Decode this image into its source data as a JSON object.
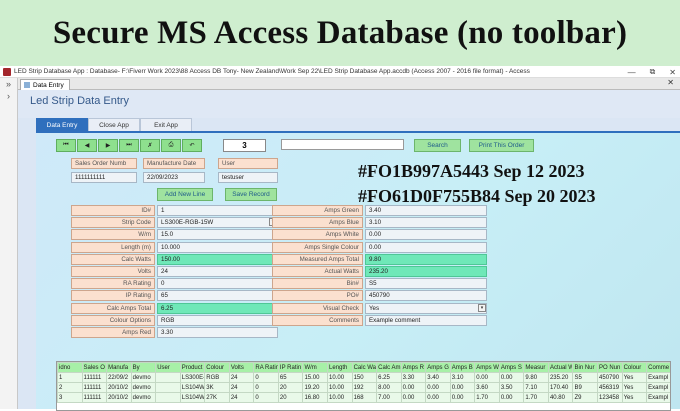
{
  "banner": {
    "title": "Secure MS Access Database (no toolbar)"
  },
  "window": {
    "title": "LED Strip Database App : Database- F:\\Fiverr Work 2023\\88 Access DB Tony- New Zealand\\Work Sep 22\\LED Strip Database App.accdb (Access 2007 - 2016 file format) - Access",
    "minimize": "—",
    "restore": "⧉",
    "close": "✕"
  },
  "nav": {
    "expand": "»",
    "collapse": "›"
  },
  "doc_tab": {
    "label": "Data Entry",
    "close": "✕"
  },
  "form": {
    "title": "Led Strip Data Entry",
    "tabs": [
      {
        "label": "Data Entry"
      },
      {
        "label": "Close App"
      },
      {
        "label": "Exit App"
      }
    ],
    "nav_buttons": {
      "first": "⏮",
      "prev": "◀",
      "next": "▶",
      "last": "⏭",
      "delete": "✗",
      "print": "⎙",
      "undo": "↶"
    },
    "record_number": "3",
    "search_value": "",
    "search_label": "Search",
    "print_order_label": "Print This Order",
    "add_new_line_label": "Add New Line",
    "save_record_label": "Save Record",
    "dropdown_glyph": "▾",
    "header_fields": {
      "sales_order_label": "Sales Order Numb",
      "sales_order_value": "1111111111",
      "manufacture_date_label": "Manufacture Date",
      "manufacture_date_value": "22/09/2023",
      "user_label": "User",
      "user_value": "testuser"
    },
    "left_fields": [
      {
        "label": "ID#",
        "value": "1"
      },
      {
        "label": "Strip Code",
        "value": "LS300E-RGB-15W"
      },
      {
        "label": "W/m",
        "value": "15.0"
      },
      {
        "label": "Length (m)",
        "value": "10.000"
      },
      {
        "label": "Calc Watts",
        "value": "150.00"
      },
      {
        "label": "Volts",
        "value": "24"
      },
      {
        "label": "RA Rating",
        "value": "0"
      },
      {
        "label": "IP Rating",
        "value": "65"
      },
      {
        "label": "Calc Amps Total",
        "value": "6.25"
      },
      {
        "label": "Colour Options",
        "value": "RGB"
      },
      {
        "label": "Amps Red",
        "value": "3.30"
      }
    ],
    "right_fields": [
      {
        "label": "Amps Green",
        "value": "3.40"
      },
      {
        "label": "Amps Blue",
        "value": "3.10"
      },
      {
        "label": "Amps White",
        "value": "0.00"
      },
      {
        "label": "Amps Single Colour",
        "value": "0.00"
      },
      {
        "label": "Measured  Amps Total",
        "value": "9.80"
      },
      {
        "label": "Actual Watts",
        "value": "235.20"
      },
      {
        "label": "Bin#",
        "value": "S5"
      },
      {
        "label": "PO#",
        "value": "450790"
      },
      {
        "label": "Visual Check",
        "value": "Yes"
      },
      {
        "label": "Comments",
        "value": "Example comment"
      }
    ]
  },
  "overlay_text": [
    "#FO1B997A5443 Sep 12 2023",
    "#FO61D0F755B84 Sep 20 2023"
  ],
  "datasheet": {
    "columns": [
      "idno",
      "Sales O",
      "Manufa",
      "By",
      "User",
      "Product",
      "Colour",
      "Volts",
      "RA Ratin",
      "IP Ratin",
      "W/m",
      "Length",
      "Calc Wa",
      "Calc Am",
      "Amps R",
      "Amps G",
      "Amps B",
      "Amps W",
      "Amps S",
      "Measur",
      "Actual W",
      "Bin Nur",
      "PO Nun",
      "Colour",
      "Comme"
    ],
    "rows": [
      [
        "1",
        "111111",
        "22/09/2",
        "devmo",
        "",
        "LS300E-",
        "RGB",
        "24",
        "0",
        "65",
        "15.00",
        "10.00",
        "150",
        "6.25",
        "3.30",
        "3.40",
        "3.10",
        "0.00",
        "0.00",
        "9.80",
        "235.20",
        "S5",
        "450790",
        "Yes",
        "Exampl"
      ],
      [
        "2",
        "111111",
        "20/10/2",
        "devmo",
        "",
        "LS104W",
        "3K",
        "24",
        "0",
        "20",
        "19.20",
        "10.00",
        "192",
        "8.00",
        "0.00",
        "0.00",
        "0.00",
        "3.60",
        "3.50",
        "7.10",
        "170.40",
        "B9",
        "456319",
        "Yes",
        "Exampl"
      ],
      [
        "3",
        "111111",
        "20/10/2",
        "devmo",
        "",
        "LS104W",
        "27K",
        "24",
        "0",
        "20",
        "16.80",
        "10.00",
        "168",
        "7.00",
        "0.00",
        "0.00",
        "0.00",
        "1.70",
        "0.00",
        "1.70",
        "40.80",
        "Z9",
        "123458",
        "Yes",
        "Exampl"
      ]
    ]
  },
  "colors": {
    "accent": "#2f6fbd",
    "banner": "#cfeecf",
    "calc_field": "#6fe8b8",
    "label_bg": "#fbe0cf",
    "button_green": "#9fe39f"
  }
}
